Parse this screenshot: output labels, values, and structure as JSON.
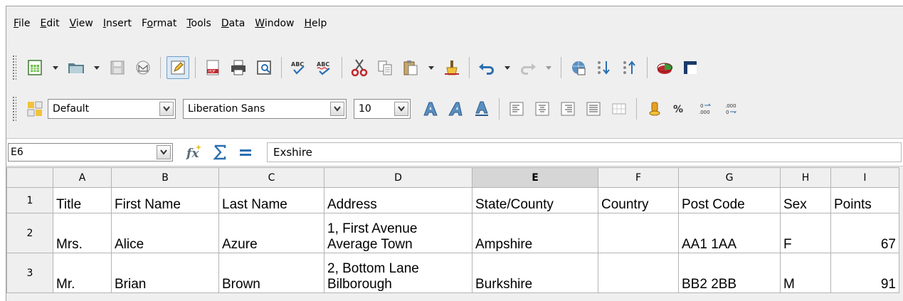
{
  "menu": {
    "items": [
      {
        "u": "F",
        "rest": "ile"
      },
      {
        "u": "E",
        "rest": "dit"
      },
      {
        "u": "V",
        "rest": "iew"
      },
      {
        "u": "I",
        "rest": "nsert"
      },
      {
        "pre": "F",
        "u": "o",
        "rest": "rmat"
      },
      {
        "u": "T",
        "rest": "ools"
      },
      {
        "u": "D",
        "rest": "ata"
      },
      {
        "u": "W",
        "rest": "indow"
      },
      {
        "u": "H",
        "rest": "elp"
      }
    ]
  },
  "formatting": {
    "style": "Default",
    "font": "Liberation Sans",
    "size": "10"
  },
  "formula_bar": {
    "cell_ref": "E6",
    "content": "Exshire"
  },
  "sheet": {
    "columns": [
      "A",
      "B",
      "C",
      "D",
      "E",
      "F",
      "G",
      "H",
      "I"
    ],
    "selected_column": "E",
    "rows": [
      {
        "num": "1",
        "cells": [
          "Title",
          "First Name",
          "Last Name",
          "Address",
          "State/County",
          "Country",
          "Post Code",
          "Sex",
          "Points"
        ]
      },
      {
        "num": "2",
        "cells": [
          "Mrs.",
          "Alice",
          "Azure",
          "1, First Avenue Average Town",
          "Ampshire",
          "",
          "AA1 1AA",
          "F",
          "67"
        ]
      },
      {
        "num": "3",
        "cells": [
          "Mr.",
          "Brian",
          "Brown",
          "2, Bottom Lane Bilborough",
          "Burkshire",
          "",
          "BB2 2BB",
          "M",
          "91"
        ]
      }
    ]
  },
  "colors": {
    "chrome": "#efefef",
    "grid_line": "#b4b4b4",
    "selected_header": "#d6d6d6"
  }
}
